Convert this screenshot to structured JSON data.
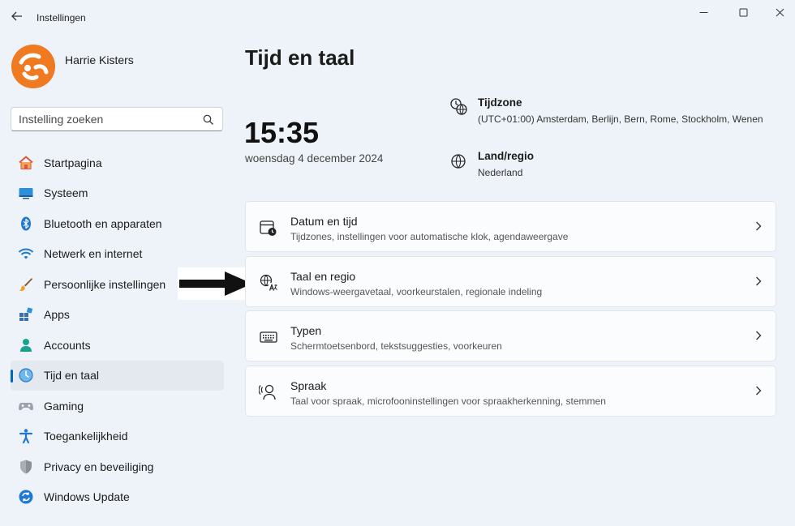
{
  "window": {
    "title": "Instellingen",
    "back_icon": "back-arrow-icon",
    "controls": [
      "minimize-icon",
      "maximize-icon",
      "close-icon"
    ]
  },
  "profile": {
    "name": "Harrie Kisters"
  },
  "search": {
    "placeholder": "Instelling zoeken"
  },
  "sidebar": {
    "items": [
      {
        "label": "Startpagina",
        "icon": "home-icon"
      },
      {
        "label": "Systeem",
        "icon": "system-icon"
      },
      {
        "label": "Bluetooth en apparaten",
        "icon": "bluetooth-icon"
      },
      {
        "label": "Netwerk en internet",
        "icon": "wifi-icon"
      },
      {
        "label": "Persoonlijke instellingen",
        "icon": "brush-icon"
      },
      {
        "label": "Apps",
        "icon": "apps-icon"
      },
      {
        "label": "Accounts",
        "icon": "accounts-icon"
      },
      {
        "label": "Tijd en taal",
        "icon": "time-language-icon",
        "active": true
      },
      {
        "label": "Gaming",
        "icon": "gamepad-icon"
      },
      {
        "label": "Toegankelijkheid",
        "icon": "accessibility-icon"
      },
      {
        "label": "Privacy en beveiliging",
        "icon": "shield-icon"
      },
      {
        "label": "Windows Update",
        "icon": "update-icon"
      }
    ]
  },
  "main": {
    "title": "Tijd en taal",
    "clock": {
      "time": "15:35",
      "date": "woensdag 4 december 2024"
    },
    "timezone": {
      "title": "Tijdzone",
      "value": "(UTC+01:00) Amsterdam, Berlijn, Bern, Rome, Stockholm, Wenen",
      "icon": "timezone-icon"
    },
    "region": {
      "title": "Land/regio",
      "value": "Nederland",
      "icon": "globe-icon"
    },
    "cards": [
      {
        "title": "Datum en tijd",
        "subtitle": "Tijdzones, instellingen voor automatische klok, agendaweergave",
        "icon": "calendar-clock-icon"
      },
      {
        "title": "Taal en regio",
        "subtitle": "Windows-weergavetaal, voorkeurstalen, regionale indeling",
        "icon": "language-icon"
      },
      {
        "title": "Typen",
        "subtitle": "Schermtoetsenbord, tekstsuggesties, voorkeuren",
        "icon": "keyboard-icon"
      },
      {
        "title": "Spraak",
        "subtitle": "Taal voor spraak, microfooninstellingen voor spraakherkenning, stemmen",
        "icon": "speech-icon"
      }
    ]
  },
  "colors": {
    "accent": "#0067c0",
    "background": "#eef3f9",
    "avatar": "#f07a22"
  }
}
